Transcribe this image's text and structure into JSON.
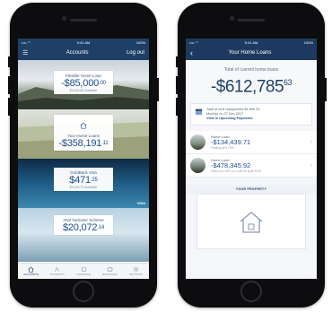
{
  "left": {
    "status": {
      "time": "9:41 AM",
      "battery": "100%"
    },
    "header": {
      "title": "Accounts",
      "logout": "Log out"
    },
    "accounts": [
      {
        "name": "Flexible Home Loan",
        "amount": "-$85,000",
        "cents": ".00",
        "sub": "$3,410.80 Available"
      },
      {
        "name": "Your Home Loans",
        "amount": "-$358,191",
        "cents": ".11",
        "sub": ""
      },
      {
        "name": "GoldBack Visa",
        "amount": "$471",
        "cents": ".25",
        "sub": "$4,126.75 Available"
      },
      {
        "name": "ANZ NoSaver Scheme",
        "amount": "$20,072",
        "cents": ".14",
        "sub": ""
      }
    ],
    "visa": "VISA",
    "tabs": [
      "ACCOUNTS",
      "PAYMENTS",
      "TRANSFER",
      "MESSAGES",
      "SETTINGS"
    ]
  },
  "right": {
    "status": {
      "time": "9:41 AM",
      "battery": "100%"
    },
    "header": {
      "title": "Your Home Loans"
    },
    "total_label": "Total of current home loans",
    "total_amount": "-$612,785",
    "total_cents": "63",
    "info": {
      "line1": "Total of next repayments $1,599.24",
      "line2": "Monthly on 27 Dec 2017",
      "link": "View in Upcoming Payments"
    },
    "loans": [
      {
        "label": "Home Loan",
        "amount": "-$134,439.71",
        "sub": "Floating at 5.79%"
      },
      {
        "label": "Home Loan",
        "amount": "-$478,345.92",
        "sub": "Fixed at 4.29% p.a. until 30 April 2018"
      }
    ],
    "property_label": "YOUR PROPERTY"
  }
}
